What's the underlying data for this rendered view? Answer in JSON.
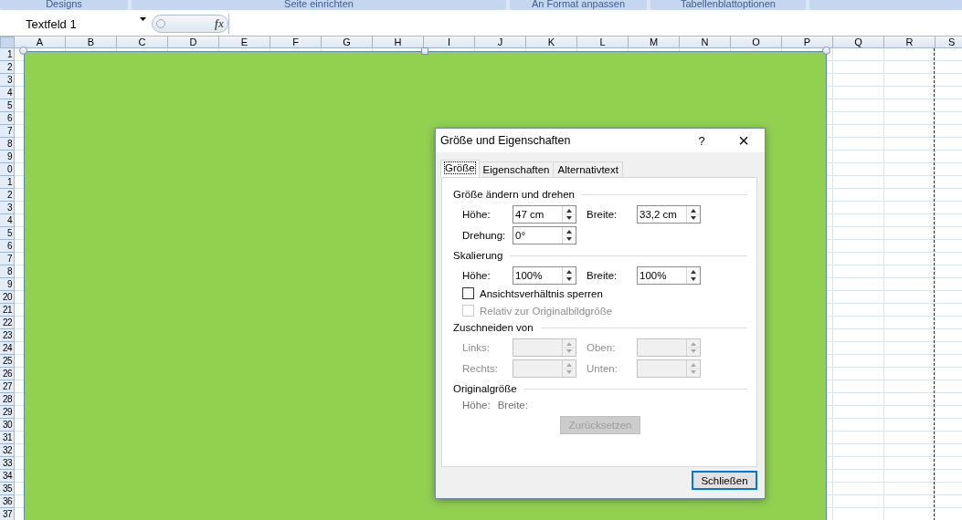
{
  "ribbon_groups": [
    {
      "label": "Designs"
    },
    {
      "label": "Seite einrichten"
    },
    {
      "label": "An Format anpassen"
    },
    {
      "label": "Tabellenblattoptionen"
    }
  ],
  "name_box": {
    "value": "Textfeld 1"
  },
  "formula_bar": {
    "fx": "fx"
  },
  "columns": [
    "A",
    "B",
    "C",
    "D",
    "E",
    "F",
    "G",
    "H",
    "I",
    "J",
    "K",
    "L",
    "M",
    "N",
    "O",
    "P",
    "Q",
    "R",
    "S"
  ],
  "rows": [
    "1",
    "2",
    "3",
    "4",
    "5",
    "6",
    "7",
    "8",
    "9",
    "0",
    "1",
    "2",
    "3",
    "4",
    "5",
    "6",
    "7",
    "8",
    "9",
    "20",
    "21",
    "22",
    "23",
    "24",
    "25",
    "26",
    "27",
    "28",
    "29",
    "30",
    "31",
    "32",
    "33",
    "34",
    "35",
    "36",
    "37"
  ],
  "shape": {
    "selected": true
  },
  "dialog": {
    "title": "Größe und Eigenschaften",
    "help": "?",
    "close": "×",
    "tabs": [
      {
        "label": "Größe",
        "selected": true
      },
      {
        "label": "Eigenschaften",
        "selected": false
      },
      {
        "label": "Alternativtext",
        "selected": false
      }
    ],
    "sections": [
      {
        "title": "Größe ändern und drehen",
        "items": [
          {
            "kind": "fields",
            "fields": [
              {
                "label": "Höhe:",
                "value": "47 cm",
                "disabled": false
              },
              {
                "label": "Breite:",
                "value": "33,2 cm",
                "disabled": false
              }
            ]
          },
          {
            "kind": "fields",
            "fields": [
              {
                "label": "Drehung:",
                "value": "0°",
                "disabled": false
              }
            ]
          }
        ]
      },
      {
        "title": "Skalierung",
        "items": [
          {
            "kind": "fields",
            "fields": [
              {
                "label": "Höhe:",
                "value": "100%",
                "disabled": false
              },
              {
                "label": "Breite:",
                "value": "100%",
                "disabled": false
              }
            ]
          },
          {
            "kind": "checkbox",
            "label": "Ansichtsverhältnis sperren",
            "checked": false,
            "disabled": false
          },
          {
            "kind": "checkbox",
            "label": "Relativ zur Originalbildgröße",
            "checked": false,
            "disabled": true
          }
        ]
      },
      {
        "title": "Zuschneiden von",
        "items": [
          {
            "kind": "fields",
            "fields": [
              {
                "label": "Links:",
                "disabled": true
              },
              {
                "label": "Oben:",
                "disabled": true
              }
            ]
          },
          {
            "kind": "fields",
            "fields": [
              {
                "label": "Rechts:",
                "disabled": true
              },
              {
                "label": "Unten:",
                "disabled": true
              }
            ]
          }
        ]
      },
      {
        "title": "Originalgröße",
        "items": [
          {
            "kind": "texts",
            "texts": [
              "Höhe:",
              "Breite:"
            ]
          },
          {
            "kind": "button",
            "label": "Zurücksetzen",
            "disabled": true
          }
        ]
      }
    ],
    "close_button": "Schließen"
  }
}
